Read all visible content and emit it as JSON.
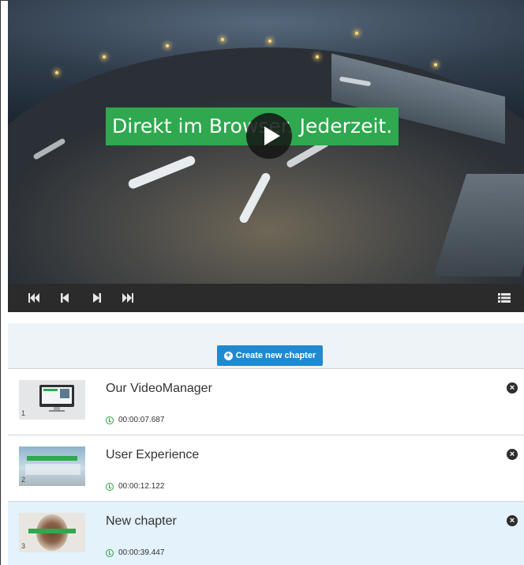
{
  "video": {
    "overlay_title": "Direkt im Browser. Jederzeit."
  },
  "controls": {
    "icons": [
      "first-chapter-icon",
      "previous-chapter-icon",
      "next-chapter-icon",
      "last-chapter-icon",
      "chapter-list-icon"
    ]
  },
  "panel": {
    "create_button_label": "Create new chapter"
  },
  "chapters": [
    {
      "number": "1",
      "title": "Our VideoManager",
      "time": "00:00:07.687",
      "active": false
    },
    {
      "number": "2",
      "title": "User Experience",
      "time": "00:00:12.122",
      "active": false
    },
    {
      "number": "3",
      "title": "New chapter",
      "time": "00:00:39.447",
      "active": true
    }
  ],
  "colors": {
    "overlay_green": "#2fa84f",
    "button_blue": "#1f8ad0",
    "active_row": "#e3f2fb",
    "clock_green": "#2aa147"
  }
}
